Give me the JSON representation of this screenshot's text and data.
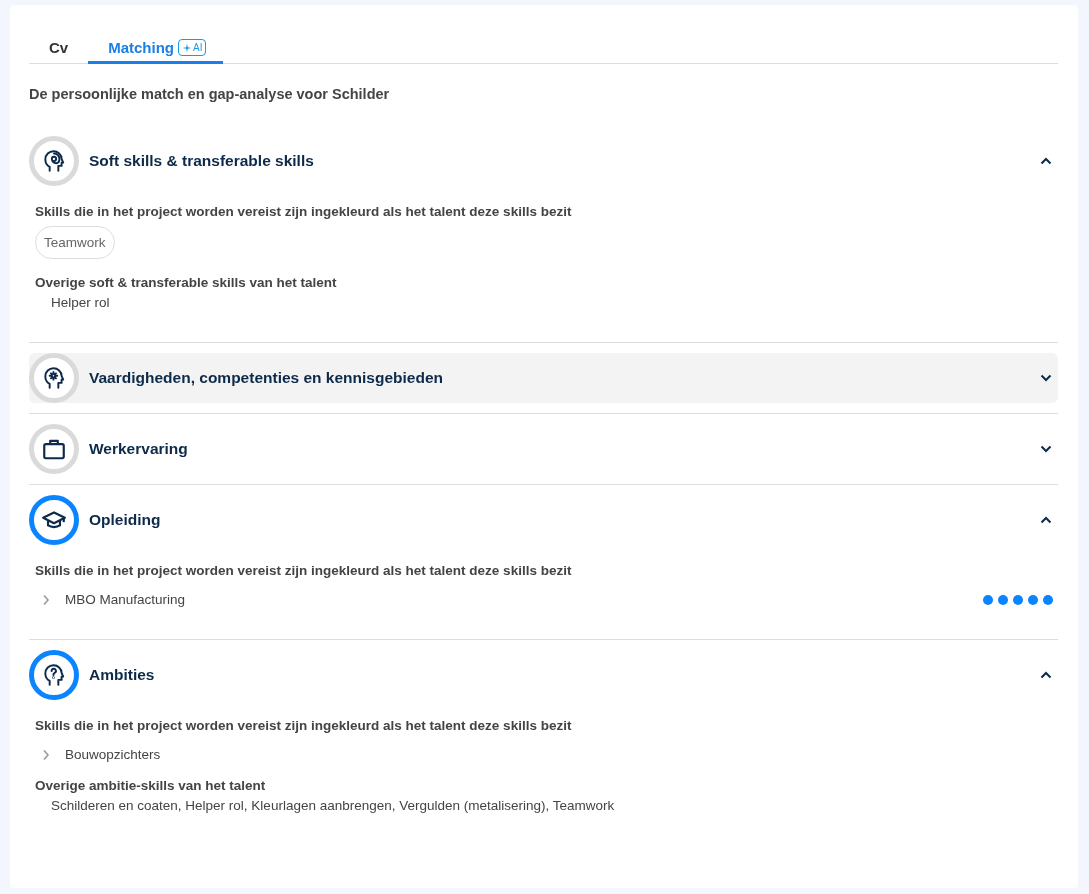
{
  "tabs": [
    {
      "label": "Cv",
      "selected": false
    },
    {
      "label": "Matching",
      "badge": "AI",
      "selected": true
    }
  ],
  "heading": "De persoonlijke match en gap-analyse voor Schilder",
  "sections": [
    {
      "kind": "head-spiral",
      "title": "Soft skills & transferable skills",
      "active": false,
      "highlighted": false,
      "expanded": true,
      "groups": [
        {
          "kind": "chips",
          "label": "Skills die in het project worden vereist zijn ingekleurd als het talent deze skills bezit",
          "items": [
            {
              "text": "Teamwork"
            }
          ]
        },
        {
          "kind": "plain",
          "label": "Overige soft & transferable skills van het talent",
          "text": "Helper rol"
        }
      ]
    },
    {
      "kind": "head-gear",
      "title": "Vaardigheden, competenties en kennisgebieden",
      "active": false,
      "highlighted": true,
      "expanded": false
    },
    {
      "kind": "briefcase",
      "title": "Werkervaring",
      "active": false,
      "highlighted": false,
      "expanded": false
    },
    {
      "kind": "cap",
      "title": "Opleiding",
      "active": true,
      "highlighted": false,
      "expanded": true,
      "groups": [
        {
          "kind": "tree",
          "label": "Skills die in het project worden vereist zijn ingekleurd als het talent deze skills bezit",
          "items": [
            {
              "text": "MBO Manufacturing",
              "expanded": false,
              "stars": 5
            }
          ]
        }
      ]
    },
    {
      "kind": "head-question",
      "title": "Ambities",
      "active": true,
      "highlighted": false,
      "expanded": true,
      "groups": [
        {
          "kind": "tree",
          "label": "Skills die in het project worden vereist zijn ingekleurd als het talent deze skills bezit",
          "items": [
            {
              "text": "Bouwopzichters",
              "expanded": false
            }
          ]
        },
        {
          "kind": "plain",
          "label": "Overige ambitie-skills van het talent",
          "text": "Schilderen en coaten, Helper rol, Kleurlagen aanbrengen, Vergulden (metalisering), Teamwork"
        }
      ]
    }
  ]
}
